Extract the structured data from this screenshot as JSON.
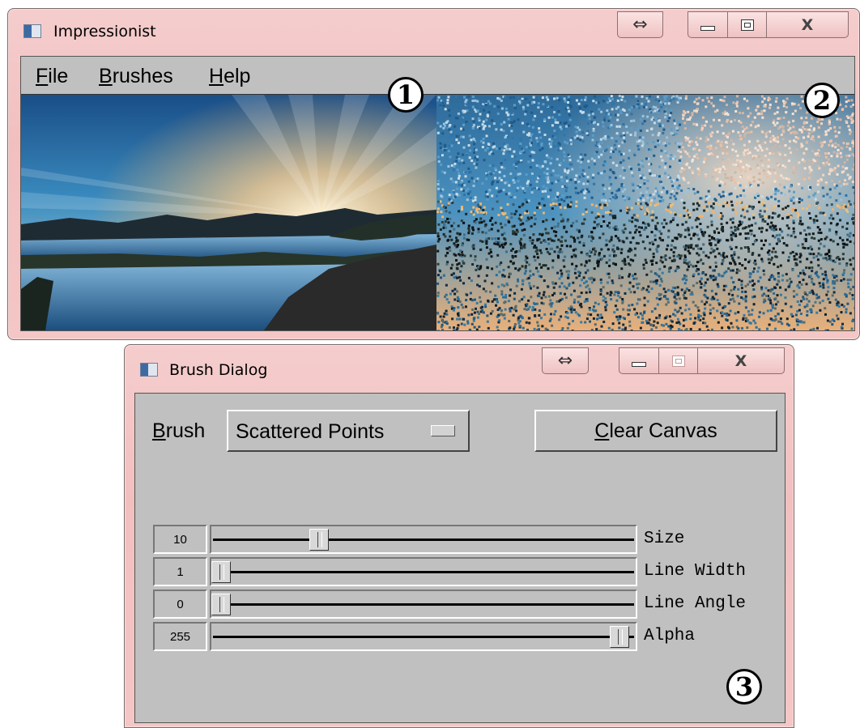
{
  "main_window": {
    "title": "Impressionist",
    "menu": [
      {
        "mnemonic": "F",
        "rest": "ile"
      },
      {
        "mnemonic": "B",
        "rest": "rushes"
      },
      {
        "mnemonic": "H",
        "rest": "elp"
      }
    ],
    "badges": [
      "1",
      "2"
    ]
  },
  "brush_dialog": {
    "title": "Brush Dialog",
    "brush_label_mnemonic": "B",
    "brush_label_rest": "rush",
    "brush_selected": "Scattered Points",
    "clear_mnemonic": "C",
    "clear_rest": "lear Canvas",
    "sliders": [
      {
        "name": "Size",
        "value": "10",
        "fraction": 0.245
      },
      {
        "name": "Line Width",
        "value": "1",
        "fraction": 0.0
      },
      {
        "name": "Line Angle",
        "value": "0",
        "fraction": 0.0
      },
      {
        "name": "Alpha",
        "value": "255",
        "fraction": 1.0
      }
    ],
    "badge": "3"
  },
  "titlebar_buttons": {
    "arrow": "⇔",
    "close": "X"
  },
  "colors": {
    "frame": "#f2bfbf",
    "client": "#c0c0c0",
    "sky_top": "#1d4f86",
    "sunset": "#f5a857"
  }
}
